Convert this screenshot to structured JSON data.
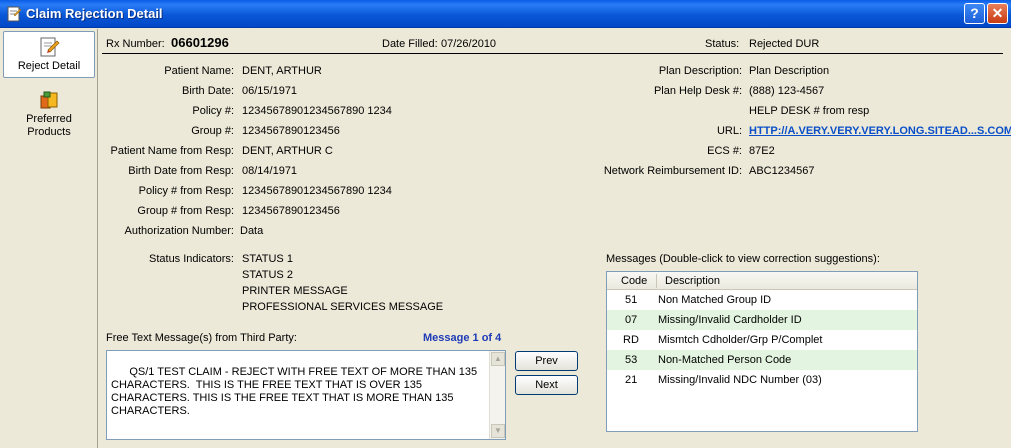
{
  "window": {
    "title": "Claim Rejection Detail",
    "help_label": "?",
    "close_label": "✕"
  },
  "nav": [
    {
      "label": "Reject Detail",
      "icon": "document-edit-icon"
    },
    {
      "label": "Preferred Products",
      "icon": "products-box-icon"
    }
  ],
  "header": {
    "rx_label": "Rx Number:",
    "rx_value": "06601296",
    "date_label": "Date Filled:",
    "date_value": "07/26/2010",
    "status_label": "Status:",
    "status_value": "Rejected  DUR"
  },
  "left_fields": [
    {
      "label": "Patient Name:",
      "value": "DENT, ARTHUR"
    },
    {
      "label": "Birth Date:",
      "value": "06/15/1971"
    },
    {
      "label": "Policy #:",
      "value": "12345678901234567890 1234"
    },
    {
      "label": "Group #:",
      "value": "1234567890123456"
    },
    {
      "label": "Patient Name from Resp:",
      "value": "DENT, ARTHUR C"
    },
    {
      "label": "Birth Date from Resp:",
      "value": "08/14/1971"
    },
    {
      "label": "Policy # from Resp:",
      "value": "12345678901234567890 1234"
    },
    {
      "label": "Group # from Resp:",
      "value": "1234567890123456"
    },
    {
      "label": "Authorization Number:",
      "value": "Data"
    }
  ],
  "right_fields": {
    "plan_desc_label": "Plan Description:",
    "plan_desc_value": "Plan Description",
    "help_desk_label": "Plan Help Desk #:",
    "help_desk_value": "(888) 123-4567",
    "help_desk_note": "HELP DESK # from resp",
    "url_label": "URL:",
    "url_value": "HTTP://A.VERY.VERY.VERY.LONG.SITEAD...S.COM",
    "ecs_label": "ECS #:",
    "ecs_value": "87E2",
    "nri_label": "Network Reimbursement ID:",
    "nri_value": "ABC1234567"
  },
  "status_indicators": {
    "label": "Status Indicators:",
    "items": [
      "STATUS 1",
      "STATUS 2",
      "PRINTER MESSAGE",
      "PROFESSIONAL SERVICES MESSAGE"
    ]
  },
  "free_text": {
    "label": "Free Text Message(s) from Third Party:",
    "counter": "Message 1 of 4",
    "text": "QS/1 TEST CLAIM - REJECT WITH FREE TEXT OF MORE THAN 135 CHARACTERS.  THIS IS THE FREE TEXT THAT IS OVER 135 CHARACTERS. THIS IS THE FREE TEXT THAT IS MORE THAN 135 CHARACTERS.",
    "prev_label": "Prev",
    "next_label": "Next"
  },
  "messages": {
    "label": "Messages (Double-click to view correction suggestions):",
    "col_code": "Code",
    "col_desc": "Description",
    "rows": [
      {
        "code": "51",
        "desc": "Non Matched Group ID"
      },
      {
        "code": "07",
        "desc": "Missing/Invalid Cardholder ID"
      },
      {
        "code": "RD",
        "desc": "Mismtch Cdholder/Grp P/Complet"
      },
      {
        "code": "53",
        "desc": "Non-Matched Person Code"
      },
      {
        "code": "21",
        "desc": "Missing/Invalid NDC Number (03)"
      }
    ]
  }
}
